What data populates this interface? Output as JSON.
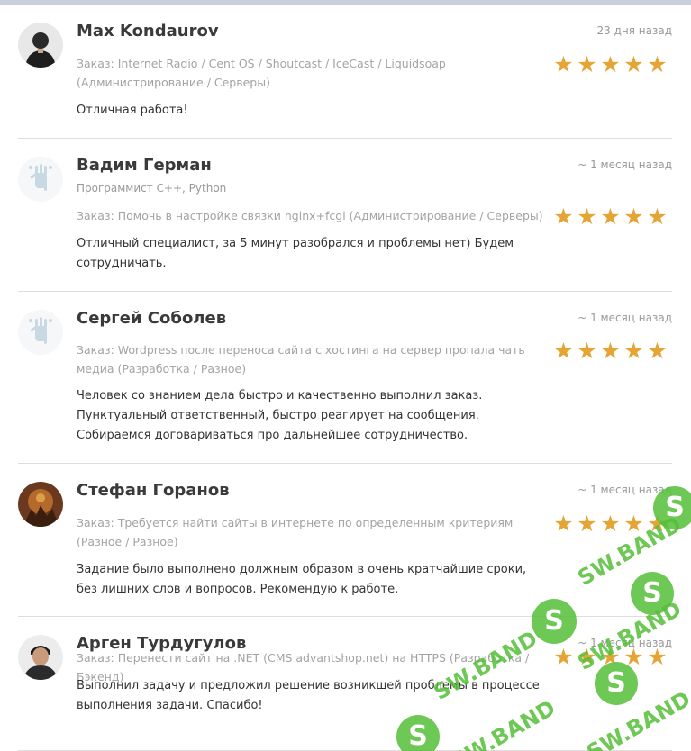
{
  "reviews": [
    {
      "name": "Max Kondaurov",
      "date": "23 дня назад",
      "role": "",
      "order": "Заказ: Internet Radio / Cent OS / Shoutcast / IceCast / Liquidsoap (Администрирование / Серверы)",
      "text": "Отличная работа!",
      "rating": 5,
      "avatar": "user-photo"
    },
    {
      "name": "Вадим Герман",
      "date": "~ 1 месяц назад",
      "role": "Программист C++, Python",
      "order": "Заказ: Помочь в настройке связки nginx+fcgi (Администрирование / Серверы)",
      "text": "Отличный специалист, за 5 минут разобрался и проблемы нет) Будем сотрудничать.",
      "rating": 5,
      "avatar": "default-hand-avatar"
    },
    {
      "name": "Сергей Соболев",
      "date": "~ 1 месяц назад",
      "role": "",
      "order": "Заказ: Wordpress после переноса сайта с хостинга на сервер пропала чать медиа (Разработка / Разное)",
      "text": "Человек со знанием дела быстро и качественно выполнил заказ. Пунктуальный ответственный, быстро реагирует на сообщения. Собираемся договариваться про дальнейшее сотрудничество.",
      "rating": 5,
      "avatar": "default-hand-avatar"
    },
    {
      "name": "Стефан Горанов",
      "date": "~ 1 месяц назад",
      "role": "",
      "order": "Заказ: Требуется найти сайты в интернете по определенным критериям (Разное / Разное)",
      "text": "Задание было выполнено должным образом в очень кратчайшие сроки, без лишних слов и вопросов. Рекомендую к работе.",
      "rating": 5,
      "avatar": "user-photo"
    },
    {
      "name": "Арген Турдугулов",
      "date": "~ 1 месяц назад",
      "role": "",
      "order": "Заказ: Перенести сайт на .NET (CMS advantshop.net) на HTTPS (Разработка / Бэкенд)",
      "text": "Выполнил задачу и предложил решение возникшей проблемы в процессе выполнения задачи. Спасибо!",
      "rating": 5,
      "avatar": "user-photo"
    }
  ],
  "star_glyph": "★",
  "colors": {
    "star": "#e4a534",
    "watermark": "#55be37"
  },
  "watermark": {
    "brand": "SW.BAND",
    "logo_letter": "S"
  }
}
